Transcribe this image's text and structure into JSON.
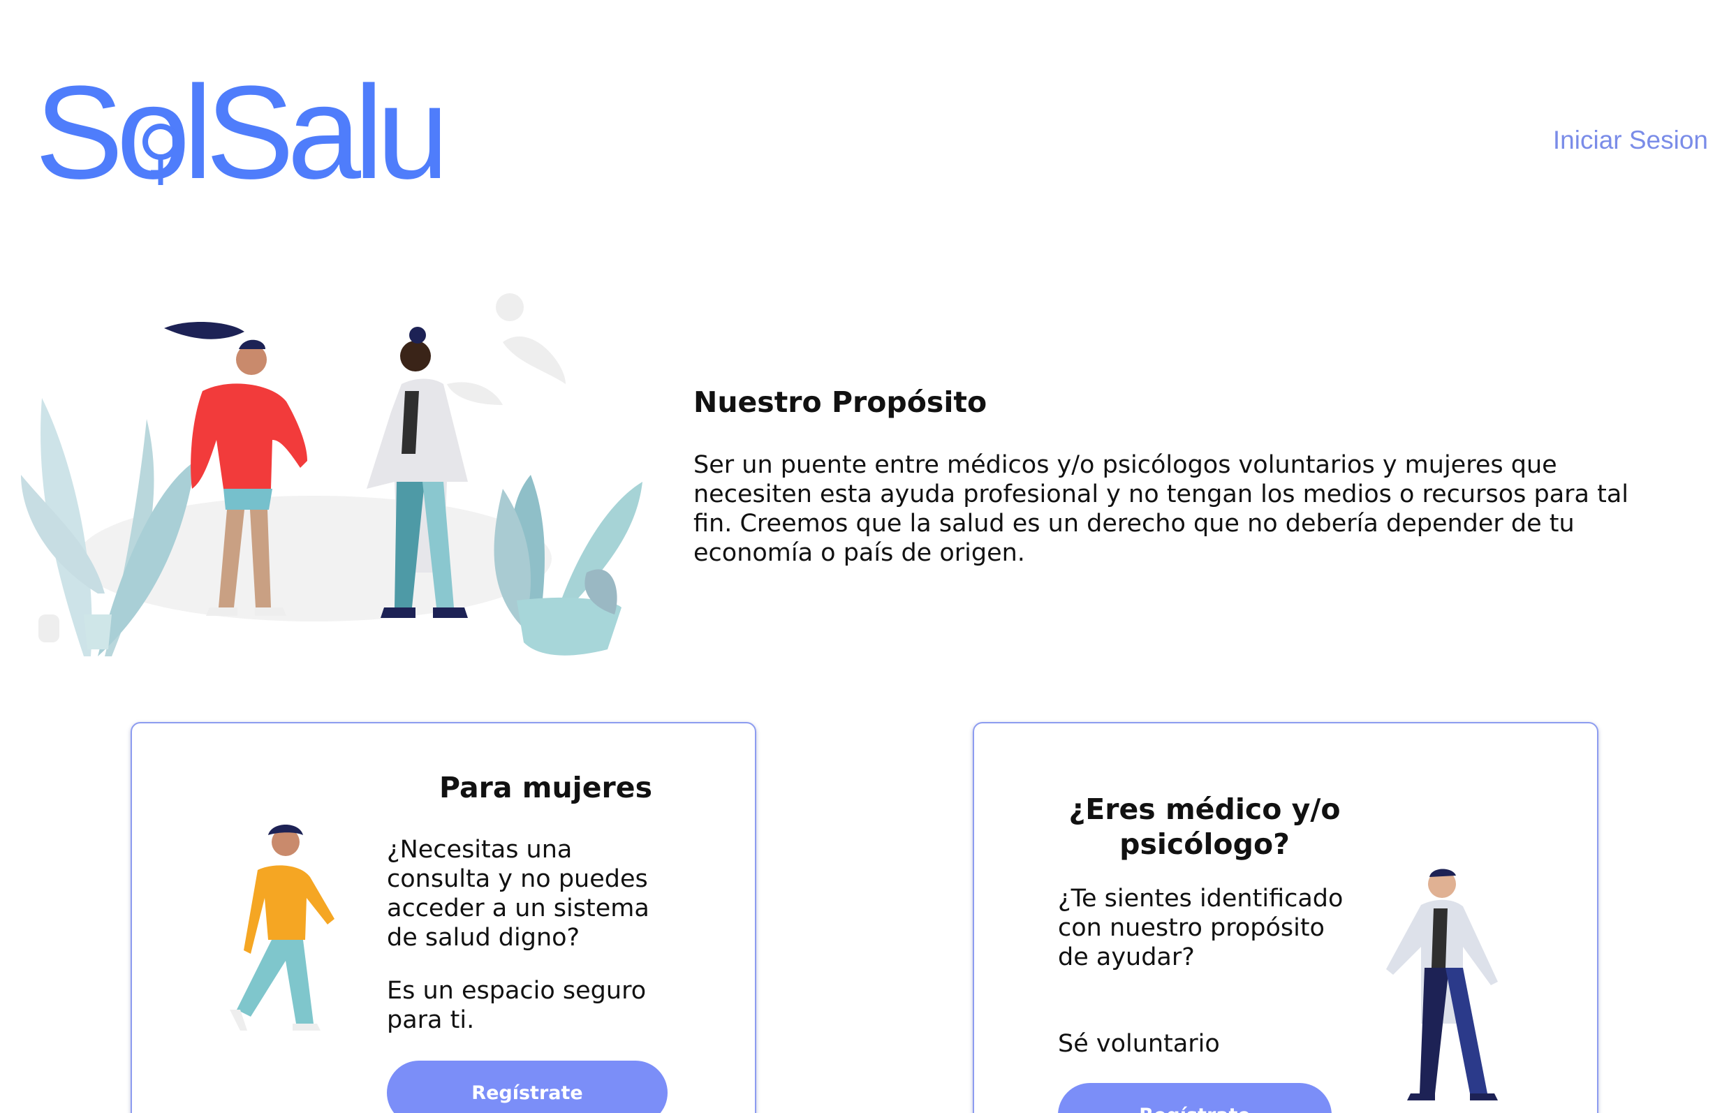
{
  "header": {
    "logo_text": "SolSalud",
    "login_label": "Iniciar Sesion"
  },
  "hero": {
    "title": "Nuestro Propósito",
    "description": "Ser un puente entre médicos y/o psicólogos voluntarios y mujeres que necesiten esta ayuda profesional y no tengan los medios o recursos para tal fin. Creemos que la salud es un derecho que no debería depender de tu economía o país de origen."
  },
  "cards": [
    {
      "title": "Para mujeres",
      "question": "¿Necesitas una consulta y no puedes acceder a un sistema de salud digno?",
      "note": "Es un espacio seguro para ti.",
      "button_label": "Regístrate"
    },
    {
      "title": "¿Eres médico y/o psicólogo?",
      "question": "¿Te sientes identificado con nuestro propósito de ayudar?",
      "note": "Sé voluntario",
      "button_label": "Regístrate"
    }
  ],
  "colors": {
    "brand": "#4f7dfb",
    "link": "#7a8ce8",
    "button": "#7b8ef8",
    "card_border": "#8d9cf0"
  }
}
